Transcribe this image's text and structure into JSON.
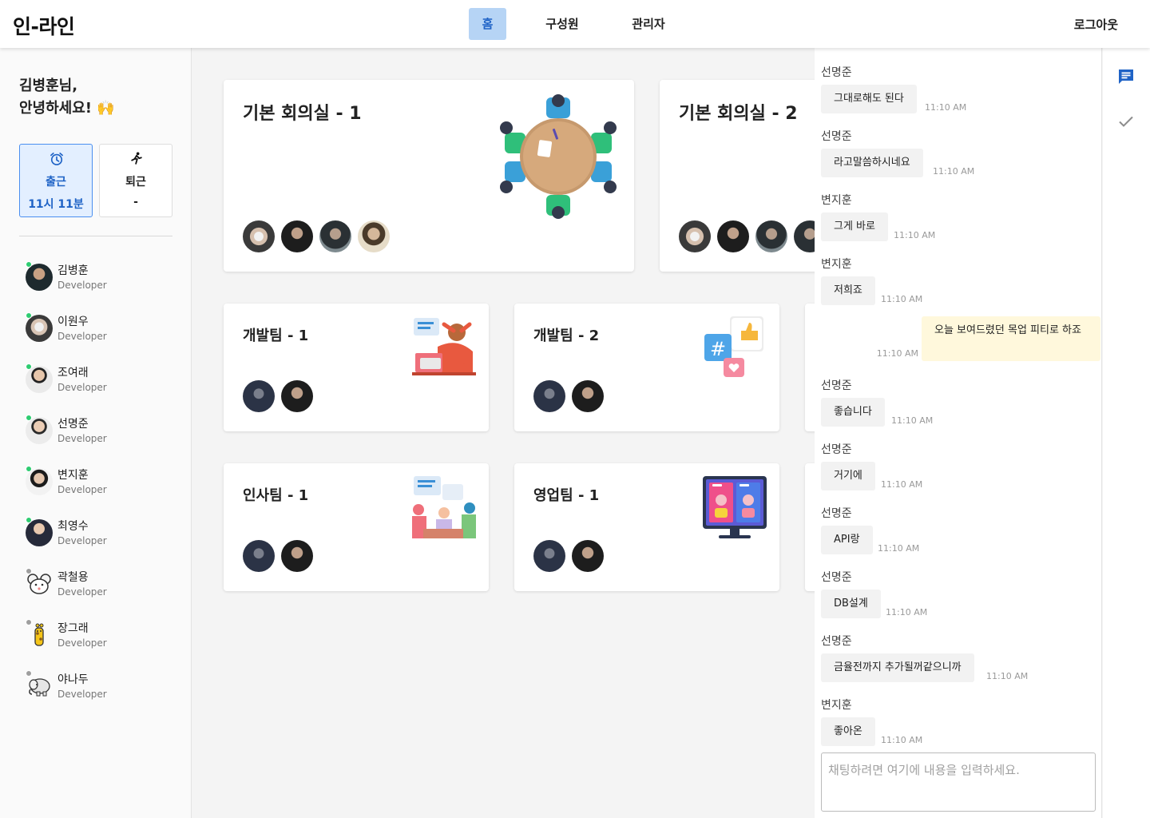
{
  "app": {
    "logo": "인-라인"
  },
  "nav": {
    "home": "홈",
    "members": "구성원",
    "admin": "관리자",
    "logout": "로그아웃"
  },
  "sidebar": {
    "greeting_line1": "김병훈님,",
    "greeting_line2": "안녕하세요! 🙌",
    "check_in": {
      "label": "출근",
      "time": "11시 11분"
    },
    "check_out": {
      "label": "퇴근",
      "time": "-"
    },
    "members": [
      {
        "name": "김병훈",
        "role": "Developer",
        "online": true
      },
      {
        "name": "이원우",
        "role": "Developer",
        "online": true
      },
      {
        "name": "조여래",
        "role": "Developer",
        "online": true
      },
      {
        "name": "선명준",
        "role": "Developer",
        "online": true
      },
      {
        "name": "변지훈",
        "role": "Developer",
        "online": true
      },
      {
        "name": "최영수",
        "role": "Developer",
        "online": true
      },
      {
        "name": "곽철용",
        "role": "Developer",
        "online": false
      },
      {
        "name": "장그래",
        "role": "Developer",
        "online": false
      },
      {
        "name": "야나두",
        "role": "Developer",
        "online": false
      }
    ]
  },
  "rooms": [
    {
      "title": "기본 회의실 - 1"
    },
    {
      "title": "기본 회의실 - 2"
    },
    {
      "title": "개발팀 - 1"
    },
    {
      "title": "개발팀 - 2"
    },
    {
      "title": "인사팀 - 1"
    },
    {
      "title": "영업팀 - 1"
    }
  ],
  "chat": {
    "messages": [
      {
        "sender": "선명준",
        "text": "그대로해도 된다",
        "time": "11:10 AM"
      },
      {
        "sender": "선명준",
        "text": "라고말씀하시네요",
        "time": "11:10 AM"
      },
      {
        "sender": "변지훈",
        "text": "그게 바로",
        "time": "11:10 AM"
      },
      {
        "sender": "변지훈",
        "text": "저희죠",
        "time": "11:10 AM"
      },
      {
        "sender": "",
        "text": "오늘 보여드렸던 목업 피티로 하죠",
        "time": "11:10 AM",
        "mine": true
      },
      {
        "sender": "선명준",
        "text": "좋습니다",
        "time": "11:10 AM"
      },
      {
        "sender": "선명준",
        "text": "거기에",
        "time": "11:10 AM"
      },
      {
        "sender": "선명준",
        "text": "API랑",
        "time": "11:10 AM"
      },
      {
        "sender": "선명준",
        "text": "DB설계",
        "time": "11:10 AM"
      },
      {
        "sender": "선명준",
        "text": "금율전까지 추가될꺼같으니까",
        "time": "11:10 AM"
      },
      {
        "sender": "변지훈",
        "text": "좋아온",
        "time": "11:10 AM"
      }
    ],
    "input_placeholder": "채팅하려면 여기에 내용을 입력하세요."
  },
  "colors": {
    "accent": "#1f63c6",
    "nav_active_bg": "#b6d4f5",
    "online": "#2ecc71",
    "offline": "#9e9e9e",
    "my_bubble": "#fff8dc"
  },
  "icons": {
    "chat": "chat-icon",
    "check": "check-icon",
    "alarm": "alarm-clock-icon",
    "run": "running-person-icon"
  }
}
